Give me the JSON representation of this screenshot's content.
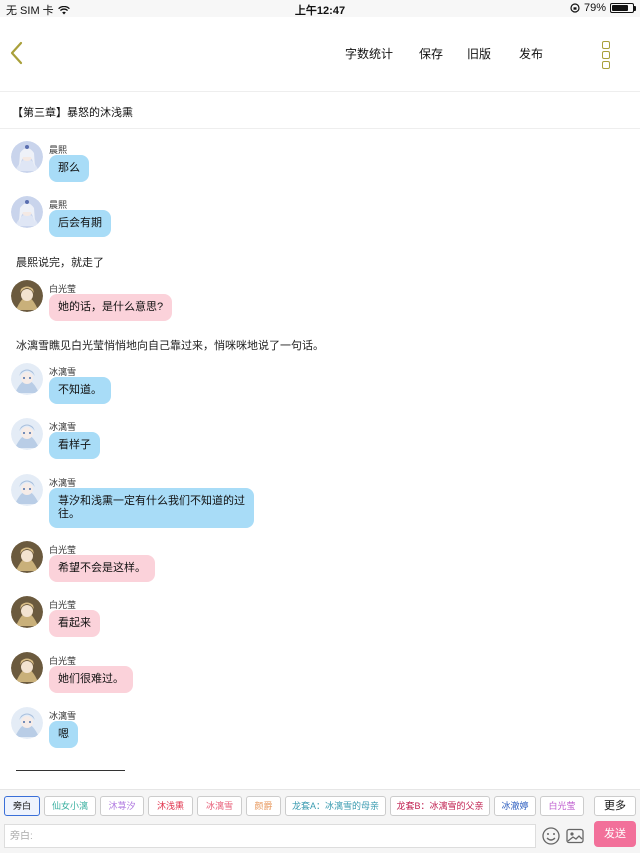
{
  "status_bar": {
    "carrier": "无 SIM 卡",
    "time": "上午12:47",
    "battery": "79%",
    "battery_level": 0.79
  },
  "header": {
    "actions": [
      "字数统计",
      "保存",
      "旧版",
      "发布"
    ]
  },
  "chapter": {
    "title": "【第三章】暴怒的沐浅熏"
  },
  "messages": [
    {
      "speaker": "晨熙",
      "text": "那么",
      "color": "blue",
      "avatar": "chenxi"
    },
    {
      "speaker": "晨熙",
      "text": "后会有期",
      "color": "blue",
      "avatar": "chenxi"
    },
    {
      "narration": "晨熙说完，就走了"
    },
    {
      "speaker": "白光莹",
      "text": "她的话，是什么意思?",
      "color": "pink",
      "avatar": "baiguangying"
    },
    {
      "narration": "冰漓雪瞧见白光莹悄悄地向自己靠过来，悄咪咪地说了一句话。"
    },
    {
      "speaker": "冰漓雪",
      "text": "不知道。",
      "color": "blue",
      "avatar": "binglixue"
    },
    {
      "speaker": "冰漓雪",
      "text": "看样子",
      "color": "blue",
      "avatar": "binglixue"
    },
    {
      "speaker": "冰漓雪",
      "text_lines": [
        "荨汐和浅熏一定有什么我们不知道的过",
        "往。"
      ],
      "color": "blue",
      "avatar": "binglixue"
    },
    {
      "speaker": "白光莹",
      "text": "希望不会是这样。",
      "color": "pink",
      "avatar": "baiguangying"
    },
    {
      "speaker": "白光莹",
      "text": "看起来",
      "color": "pink",
      "avatar": "baiguangying"
    },
    {
      "speaker": "白光莹",
      "text": "她们很难过。",
      "color": "pink",
      "avatar": "baiguangying"
    },
    {
      "speaker": "冰漓雪",
      "text": "嗯",
      "color": "blue",
      "avatar": "binglixue"
    }
  ],
  "role_chips": [
    {
      "label": "旁白",
      "color": "#111111",
      "selected": true
    },
    {
      "label": "仙女小漓",
      "color": "#3ab0a0"
    },
    {
      "label": "沐荨汐",
      "color": "#b07ae0"
    },
    {
      "label": "沐浅熏",
      "color": "#e0304a"
    },
    {
      "label": "冰漓雪",
      "color": "#e8607a"
    },
    {
      "label": "颜爵",
      "color": "#e89a60"
    },
    {
      "label": "龙套A：冰漓雪的母亲",
      "color": "#3a9bb0"
    },
    {
      "label": "龙套B：冰漓雪的父亲",
      "color": "#c02050"
    },
    {
      "label": "冰澈婷",
      "color": "#3060c0"
    },
    {
      "label": "白光莹",
      "color": "#c060d0"
    }
  ],
  "more_label": "更多",
  "input": {
    "placeholder": "旁白:",
    "value": ""
  },
  "send_label": "发送",
  "colors": {
    "accent": "#f2709a",
    "bubble_blue": "#a8dcf7",
    "bubble_pink": "#fbd2da"
  },
  "icons": {
    "back": "chevron-left-icon",
    "more": "vertical-squares-icon",
    "emoji": "smiley-icon",
    "image": "image-icon"
  }
}
